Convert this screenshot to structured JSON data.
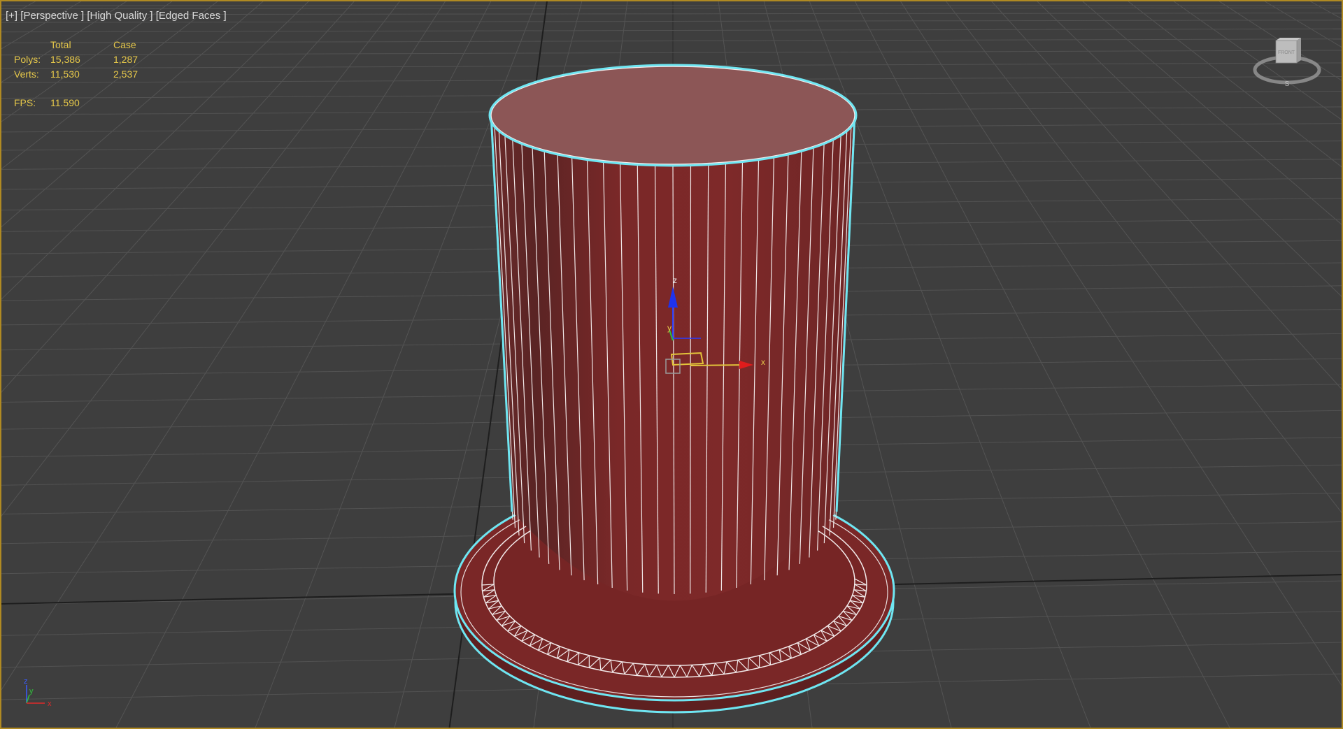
{
  "viewport": {
    "label_plus": "[+]",
    "label_view": "[Perspective ]",
    "label_quality": "[High Quality ]",
    "label_shading": "[Edged Faces ]"
  },
  "stats": {
    "header_total": "Total",
    "header_case": "Case",
    "polys_label": "Polys:",
    "polys_total": "15,386",
    "polys_case": "1,287",
    "verts_label": "Verts:",
    "verts_total": "11,530",
    "verts_case": "2,537",
    "fps_label": "FPS:",
    "fps_value": "11.590"
  },
  "gizmo": {
    "axis_x": "x",
    "axis_y": "y",
    "axis_z": "z"
  },
  "viewcube": {
    "face_label": "FRONT",
    "compass_south": "S"
  },
  "triad": {
    "axis_x": "x",
    "axis_y": "y",
    "axis_z": "z"
  },
  "colors": {
    "background": "#3e3e3e",
    "grid_line": "#555555",
    "grid_axis": "#1e1e1e",
    "object_body": "#7c2a2a",
    "object_top": "#8c5656",
    "selection_outline": "#6fe6f2",
    "viewport_border": "#b08a22",
    "stats_text": "#e6c84a"
  }
}
